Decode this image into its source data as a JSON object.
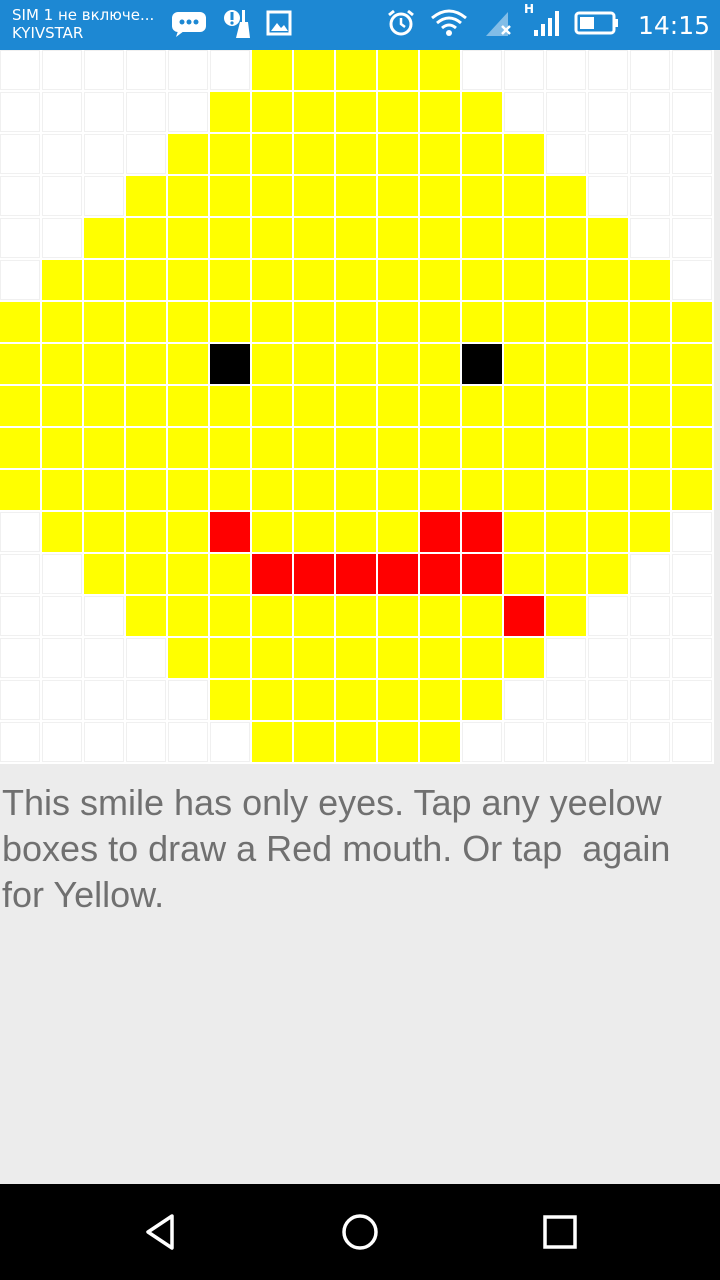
{
  "status_bar": {
    "sim_status": "SIM 1 не включе...",
    "carrier": "KYIVSTAR",
    "time": "14:15",
    "network_type": "H",
    "background_color": "#1d88d3",
    "icons": [
      "chat-icon",
      "cleaner-icon",
      "image-icon",
      "alarm-icon",
      "wifi-icon",
      "no-signal-icon",
      "signal-icon",
      "battery-icon"
    ]
  },
  "pixel_grid": {
    "columns": 17,
    "colors": {
      "W": "#ffffff",
      "Y": "#ffff00",
      "R": "#ff0000",
      "B": "#000000"
    },
    "rows": [
      "WWWWWWYYYYYWWWWWW",
      "WWWWWYYYYYYYWWWWW",
      "WWWWYYYYYYYYYWWWW",
      "WWWYYYYYYYYYYYWWW",
      "WWYYYYYYYYYYYYYWW",
      "WYYYYYYYYYYYYYYYW",
      "YYYYYYYYYYYYYYYYY",
      "YYYYYBYYYYYBYYYYY",
      "YYYYYYYYYYYYYYYYY",
      "YYYYYYYYYYYYYYYYY",
      "YYYYYYYYYYYYYYYYY",
      "WYYYYRYYYYRRYYYYW",
      "WWYYYYRRRRRRYYYWW",
      "WWWYYYYYYYYYRYWWW",
      "WWWWYYYYYYYYYWWWW",
      "WWWWWYYYYYYYWWWWW",
      "WWWWWWYYYYYWWWWWW"
    ]
  },
  "instructions": "This smile has only eyes. Tap any yeelow boxes to draw a Red mouth. Or tap  again for Yellow.",
  "nav_bar": {
    "buttons": [
      "back-icon",
      "home-icon",
      "recents-icon"
    ]
  }
}
